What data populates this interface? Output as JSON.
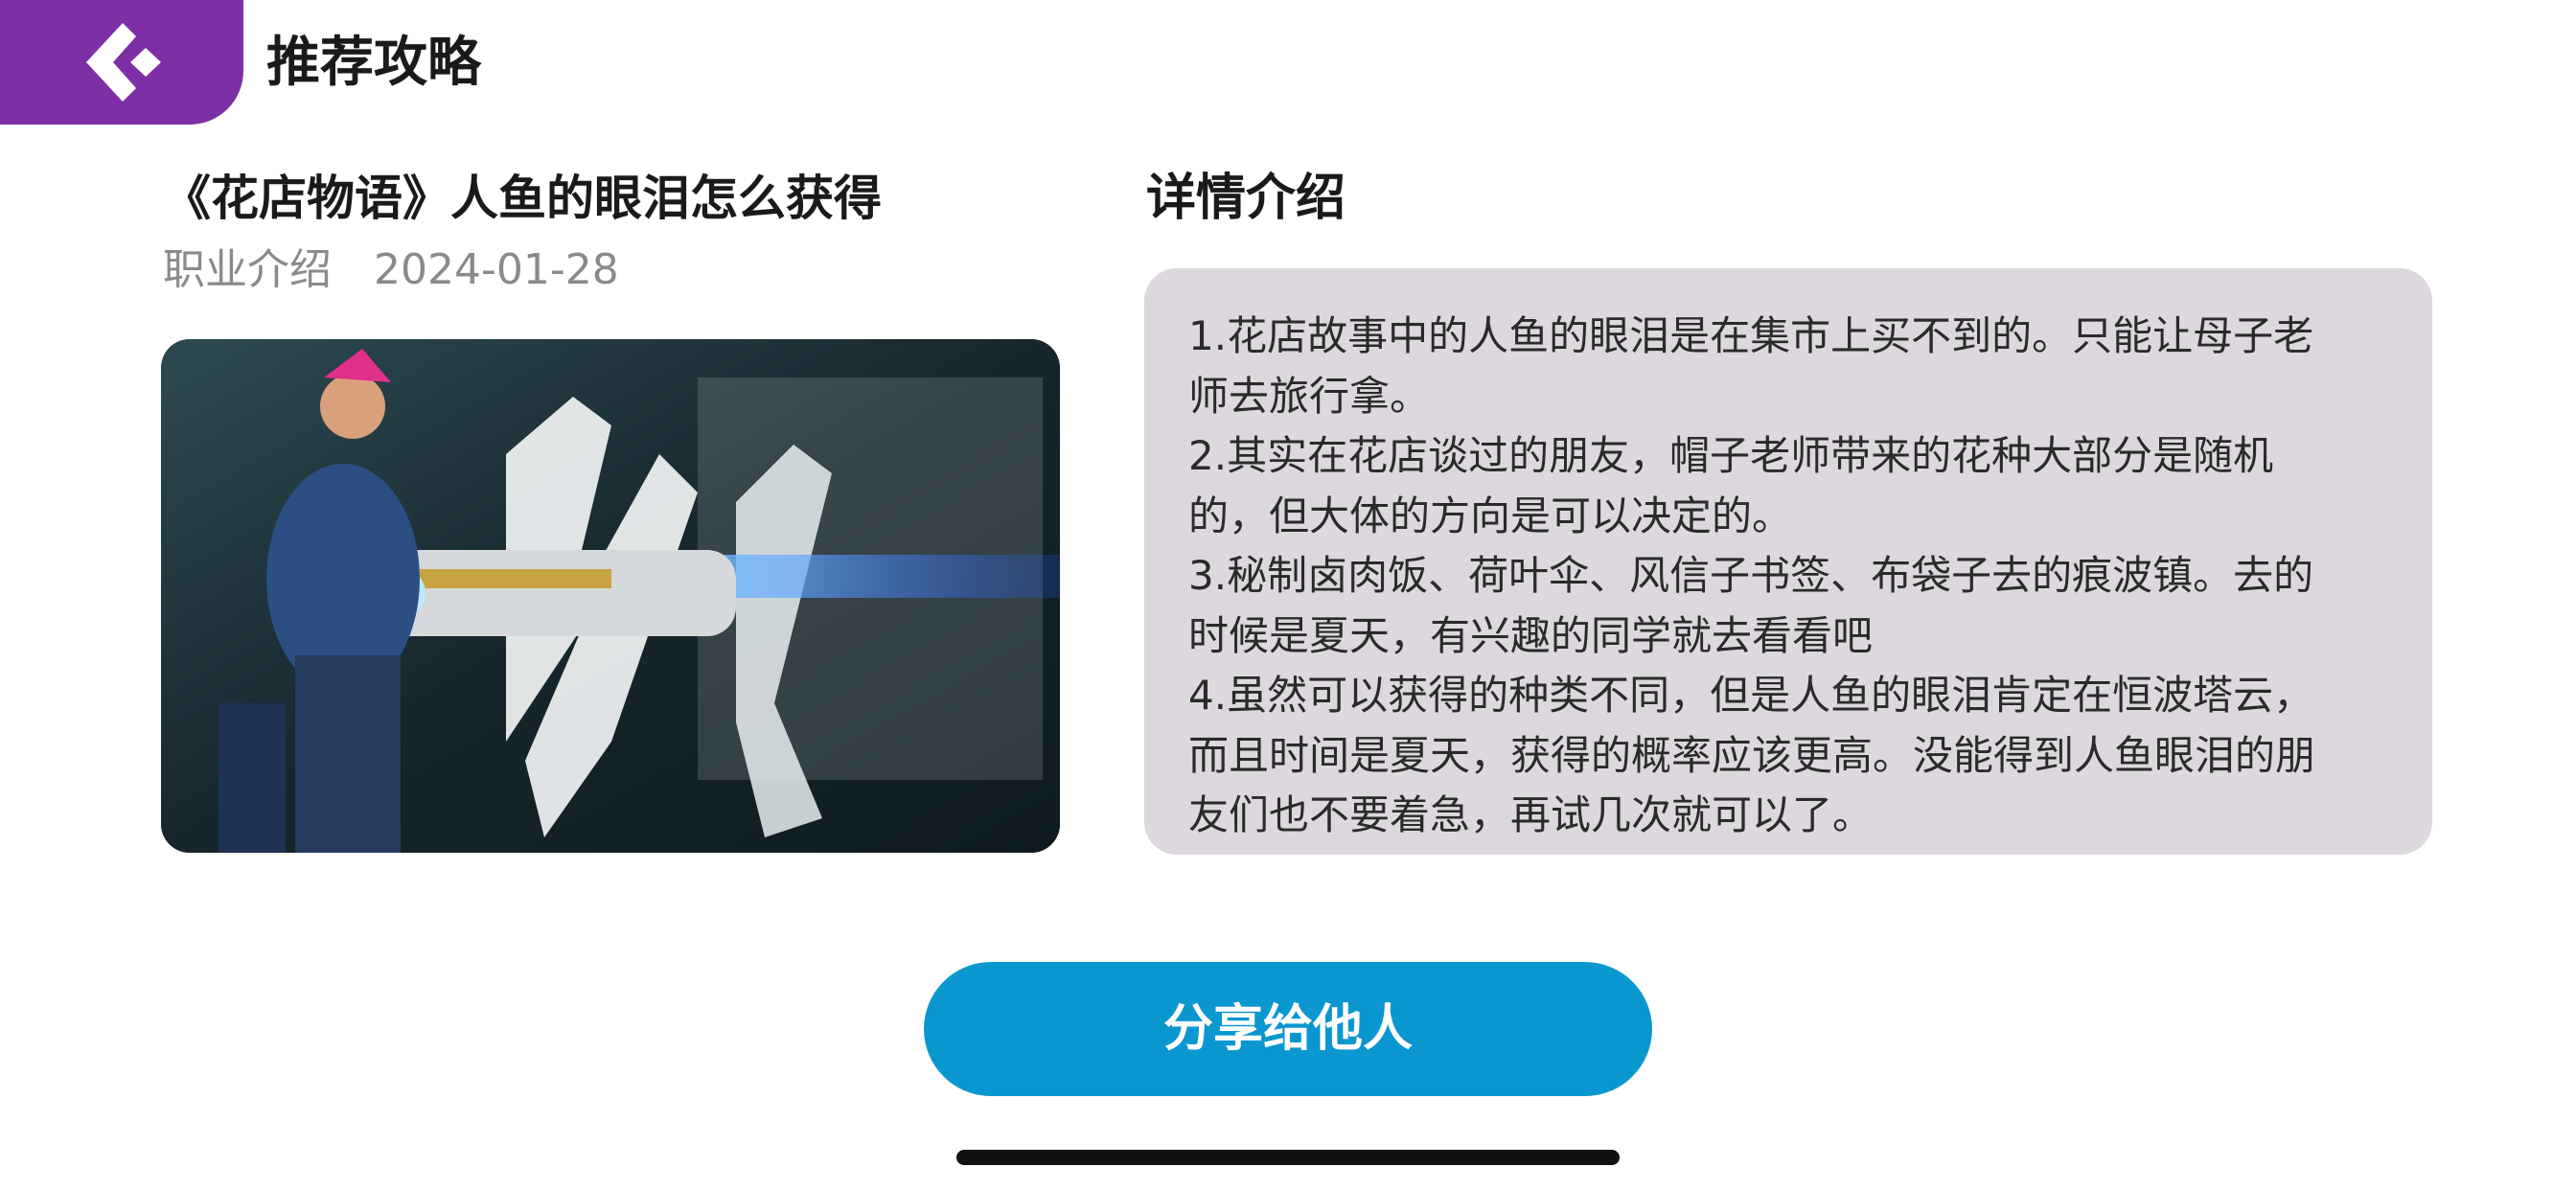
{
  "header": {
    "back_icon": "back-arrow-diamond-icon",
    "title": "推荐攻略"
  },
  "article": {
    "title": "《花店物语》人鱼的眼泪怎么获得",
    "category": "职业介绍",
    "date": "2024-01-28",
    "cover_image": "character-artwork-with-gun"
  },
  "detail": {
    "heading": "详情介绍",
    "lines": [
      "1.花店故事中的人鱼的眼泪是在集市上买不到的。只能让母子老",
      "师去旅行拿。",
      "2.其实在花店谈过的朋友，帽子老师带来的花种大部分是随机",
      "的，但大体的方向是可以决定的。",
      "3.秘制卤肉饭、荷叶伞、风信子书签、布袋子去的痕波镇。去的",
      "时候是夏天，有兴趣的同学就去看看吧",
      "4.虽然可以获得的种类不同，但是人鱼的眼泪肯定在恒波塔云，",
      "而且时间是夏天，获得的概率应该更高。没能得到人鱼眼泪的朋",
      "友们也不要着急，再试几次就可以了。"
    ]
  },
  "actions": {
    "share_label": "分享给他人"
  },
  "colors": {
    "accent_purple": "#7d2fa6",
    "share_blue": "#0a97cf",
    "detail_bg": "#dcd8dd"
  }
}
